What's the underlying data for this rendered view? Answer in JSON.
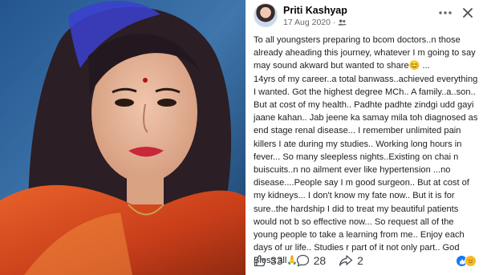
{
  "post": {
    "author": "Priti Kashyap",
    "date": "17 Aug 2020",
    "audience_icon": "friends-icon",
    "text": "To all youngsters preparing to bcom doctors..n those already aheading this journey, whatever I m going to say may sound akward but wanted to share😊 ...\n14yrs of my career..a total banwass..achieved everything I wanted. Got the highest degree MCh.. A family..a..son.. But at cost of my health.. Padhte padhte zindgi udd gayi jaane kahan.. Jab jeene ka samay mila toh diagnosed as end stage renal disease... I remember unlimited pain killers I ate during my studies.. Working long hours in fever... So many sleepless nights..Existing on chai n buiscuits..n no ailment ever like hypertension ...no disease....People say I m good surgeon.. But at cost of my kidneys... I don't know my fate now.. But it is for sure..the hardship I did to treat my beautiful patients would not b so effective now... So request all of the young people to take a learning from me.. Enjoy each days of ur life.. Studies r part of it not only part.. God Bless all🙏"
  },
  "footer": {
    "likes": "33",
    "comments": "28",
    "shares": "2"
  },
  "icons": {
    "more": "more-horizontal-icon",
    "close": "close-icon",
    "like": "thumbs-up-icon",
    "comment": "comment-icon",
    "share": "share-icon",
    "reactions": [
      "like-reaction-icon",
      "sad-reaction-icon"
    ]
  },
  "colors": {
    "accent": "#1877f2",
    "secondary_text": "#65676b"
  }
}
